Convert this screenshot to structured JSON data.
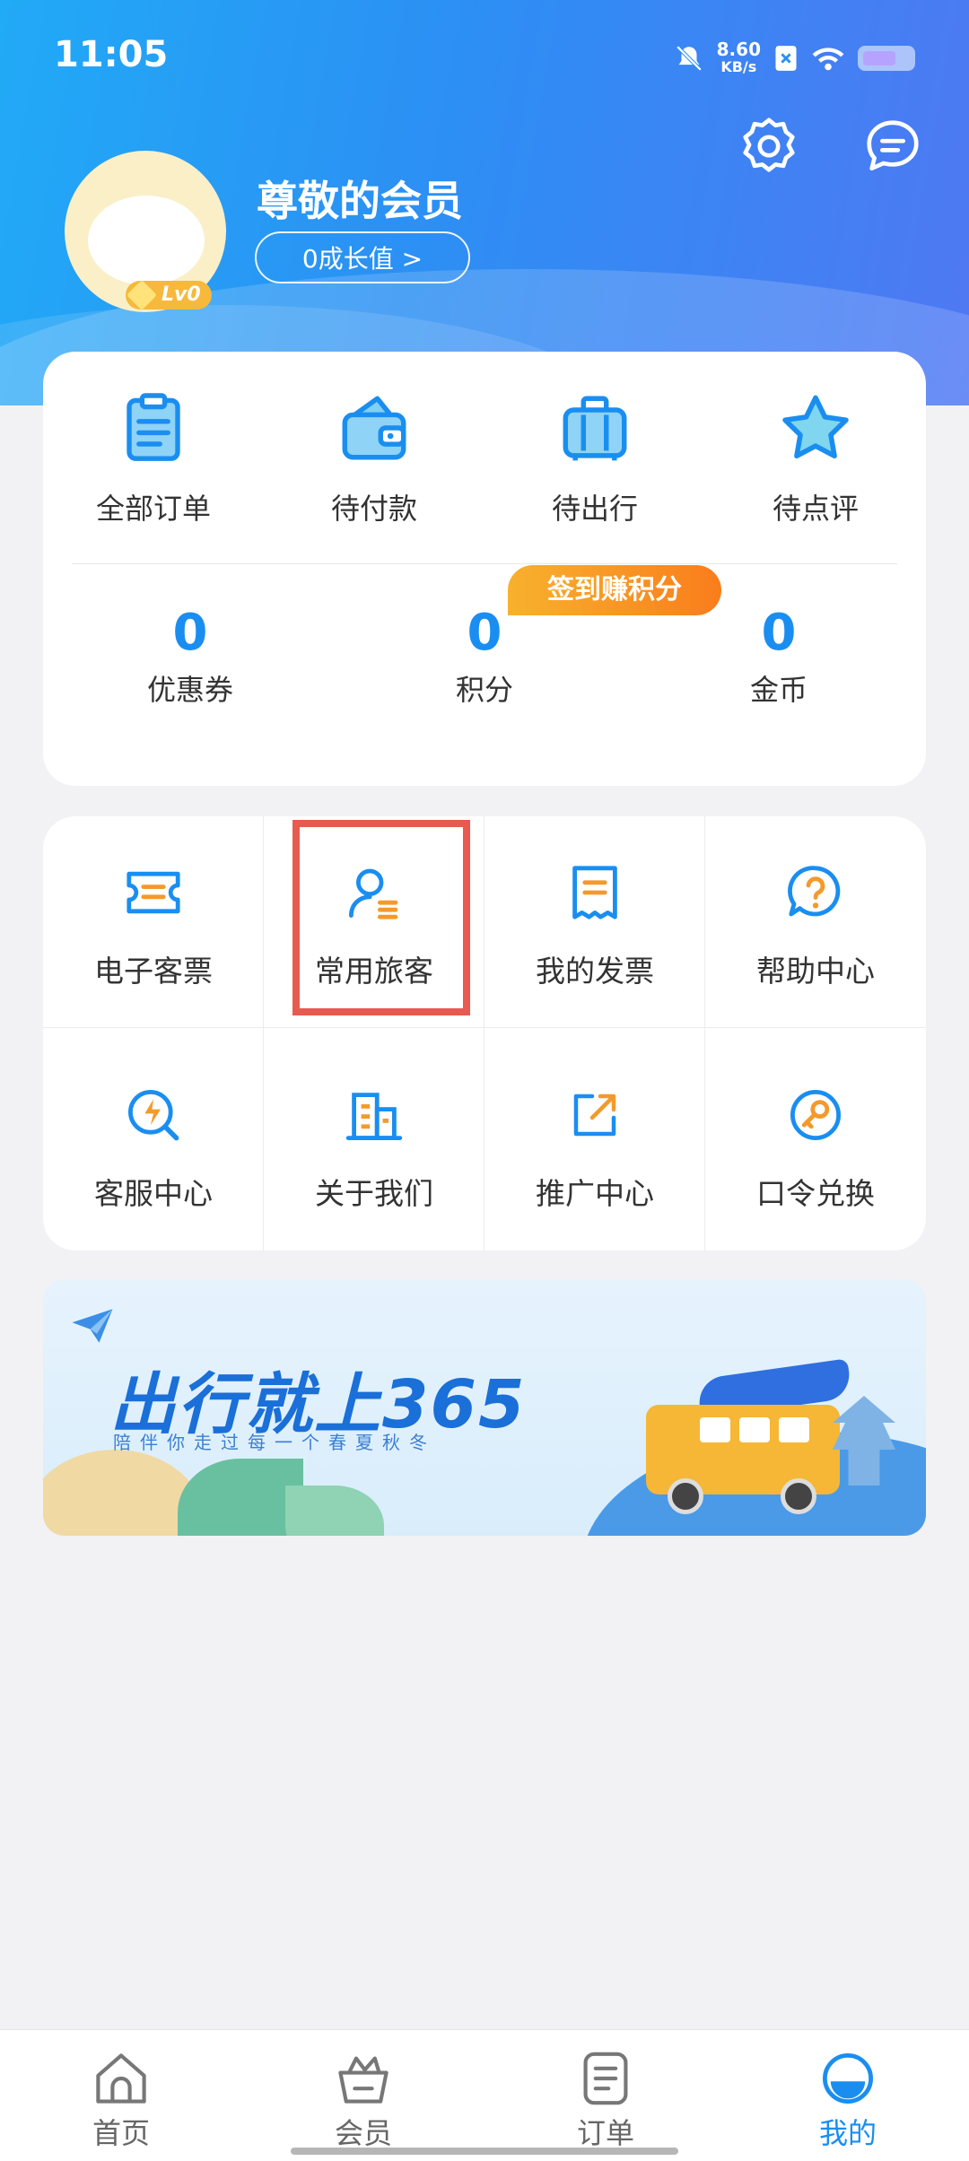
{
  "status_bar": {
    "time": "11:05",
    "network_speed": "8.60",
    "speed_unit": "KB/s"
  },
  "profile": {
    "name": "尊敬的会员",
    "growth_button": "0成长值 >",
    "level": "Lv0"
  },
  "orders": [
    {
      "label": "全部订单",
      "icon": "clipboard-icon"
    },
    {
      "label": "待付款",
      "icon": "wallet-icon"
    },
    {
      "label": "待出行",
      "icon": "suitcase-icon"
    },
    {
      "label": "待点评",
      "icon": "star-icon"
    }
  ],
  "stats": [
    {
      "value": "0",
      "label": "优惠券"
    },
    {
      "value": "0",
      "label": "积分"
    },
    {
      "value": "0",
      "label": "金币"
    }
  ],
  "sign_badge": "签到赚积分",
  "services": [
    {
      "label": "电子客票",
      "icon": "ticket-icon"
    },
    {
      "label": "常用旅客",
      "icon": "passenger-icon"
    },
    {
      "label": "我的发票",
      "icon": "invoice-icon"
    },
    {
      "label": "帮助中心",
      "icon": "help-icon"
    },
    {
      "label": "客服中心",
      "icon": "customer-service-icon"
    },
    {
      "label": "关于我们",
      "icon": "building-icon"
    },
    {
      "label": "推广中心",
      "icon": "share-icon"
    },
    {
      "label": "口令兑换",
      "icon": "key-icon"
    }
  ],
  "banner": {
    "headline": "出行就上365",
    "subline": "陪伴你走过每一个春夏秋冬"
  },
  "tabs": [
    {
      "label": "首页",
      "icon": "home-icon"
    },
    {
      "label": "会员",
      "icon": "member-basket-icon"
    },
    {
      "label": "订单",
      "icon": "order-icon"
    },
    {
      "label": "我的",
      "icon": "profile-icon"
    }
  ],
  "colors": {
    "accent": "#1a8ef0",
    "icon_orange": "#f39a2b",
    "highlight": "#e85a50"
  }
}
